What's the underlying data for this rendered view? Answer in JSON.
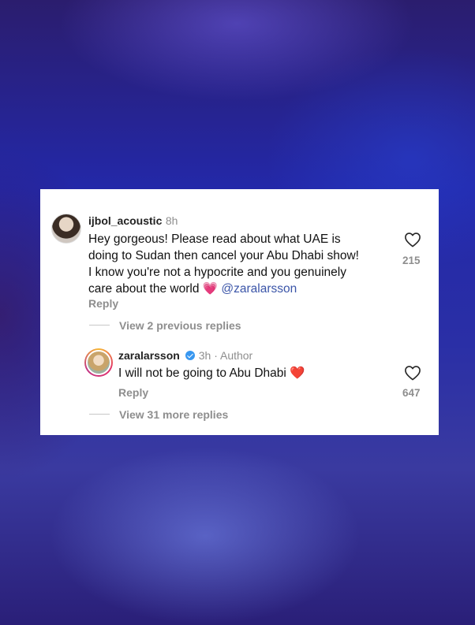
{
  "comment": {
    "username": "ijbol_acoustic",
    "time": "8h",
    "text_lines": [
      "Hey gorgeous! Please read about what UAE is",
      "doing to Sudan then cancel your Abu Dhabi show!",
      "I know you're not a hypocrite and you genuinely",
      "care about the world"
    ],
    "emoji": "💗",
    "mention": "@zaralarsson",
    "reply_label": "Reply",
    "likes": "215",
    "view_previous": "View 2 previous replies"
  },
  "reply": {
    "username": "zaralarsson",
    "time": "3h · Author",
    "text": "I will not be going to Abu Dhabi",
    "emoji": "❤️",
    "reply_label": "Reply",
    "likes": "647",
    "view_more": "View 31 more replies"
  },
  "icons": {
    "like": "heart-outline-icon",
    "verified": "verified-badge-icon"
  },
  "colors": {
    "mention": "#3b55a8",
    "verified": "#3897f0",
    "muted": "#8e8e8e"
  }
}
